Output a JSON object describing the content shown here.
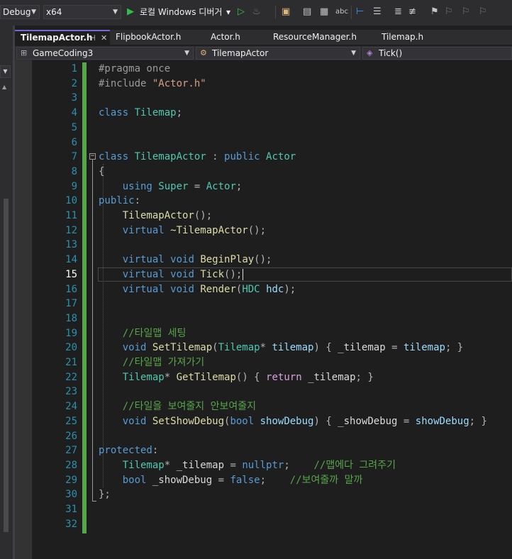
{
  "toolbar": {
    "config": "Debug",
    "platform": "x64",
    "run_label": "로컬 Windows 디버거",
    "run_dropdown": "▾"
  },
  "tabs": [
    {
      "label": "TilemapActor.h",
      "active": true
    },
    {
      "label": "FlipbookActor.h"
    },
    {
      "label": "Actor.h"
    },
    {
      "label": "ResourceManager.h"
    },
    {
      "label": "Tilemap.h"
    }
  ],
  "nav": {
    "project": "GameCoding3",
    "class": "TilemapActor",
    "member": "Tick()"
  },
  "editor": {
    "current_line": 15,
    "line_numbers": [
      "1",
      "2",
      "3",
      "4",
      "5",
      "6",
      "7",
      "8",
      "9",
      "10",
      "11",
      "12",
      "13",
      "14",
      "15",
      "16",
      "17",
      "18",
      "19",
      "20",
      "21",
      "22",
      "23",
      "24",
      "25",
      "26",
      "27",
      "28",
      "29",
      "30",
      "31",
      "32"
    ],
    "lines": {
      "l1": [
        "#pragma once"
      ],
      "l2": [
        "#include ",
        "\"Actor.h\""
      ],
      "l4": [
        "class ",
        "Tilemap",
        ";"
      ],
      "l7": [
        "class ",
        "TilemapActor",
        " : ",
        "public ",
        "Actor"
      ],
      "l8": [
        "{"
      ],
      "l9": [
        "    using ",
        "Super",
        " = ",
        "Actor",
        ";"
      ],
      "l10": [
        "public",
        ":"
      ],
      "l11": [
        "    ",
        "TilemapActor",
        "();"
      ],
      "l12": [
        "    virtual ",
        "~TilemapActor",
        "();"
      ],
      "l14": [
        "    virtual ",
        "void ",
        "BeginPlay",
        "();"
      ],
      "l15": [
        "    virtual ",
        "void ",
        "Tick",
        "();"
      ],
      "l16": [
        "    virtual ",
        "void ",
        "Render",
        "(",
        "HDC",
        " ",
        "hdc",
        ");"
      ],
      "l19": [
        "    //타일맵 세팅"
      ],
      "l20": [
        "    void ",
        "SetTilemap",
        "(",
        "Tilemap",
        "* ",
        "tilemap",
        ") { ",
        "_tilemap",
        " = ",
        "tilemap",
        "; }"
      ],
      "l21": [
        "    //타일맵 가져가기"
      ],
      "l22": [
        "    ",
        "Tilemap",
        "* ",
        "GetTilemap",
        "() { ",
        "return ",
        "_tilemap",
        "; }"
      ],
      "l24": [
        "    //타일을 보여줄지 안보여줄지"
      ],
      "l25": [
        "    void ",
        "SetShowDebug",
        "(",
        "bool ",
        "showDebug",
        ") { ",
        "_showDebug",
        " = ",
        "showDebug",
        "; }"
      ],
      "l27": [
        "protected",
        ":"
      ],
      "l28": [
        "    ",
        "Tilemap",
        "* ",
        "_tilemap",
        " = ",
        "nullptr",
        ";    ",
        "//맵에다 그려주기"
      ],
      "l29": [
        "    bool ",
        "_showDebug",
        " = ",
        "false",
        ";    ",
        "//보여줄까 말까"
      ],
      "l30": [
        "};"
      ]
    }
  }
}
